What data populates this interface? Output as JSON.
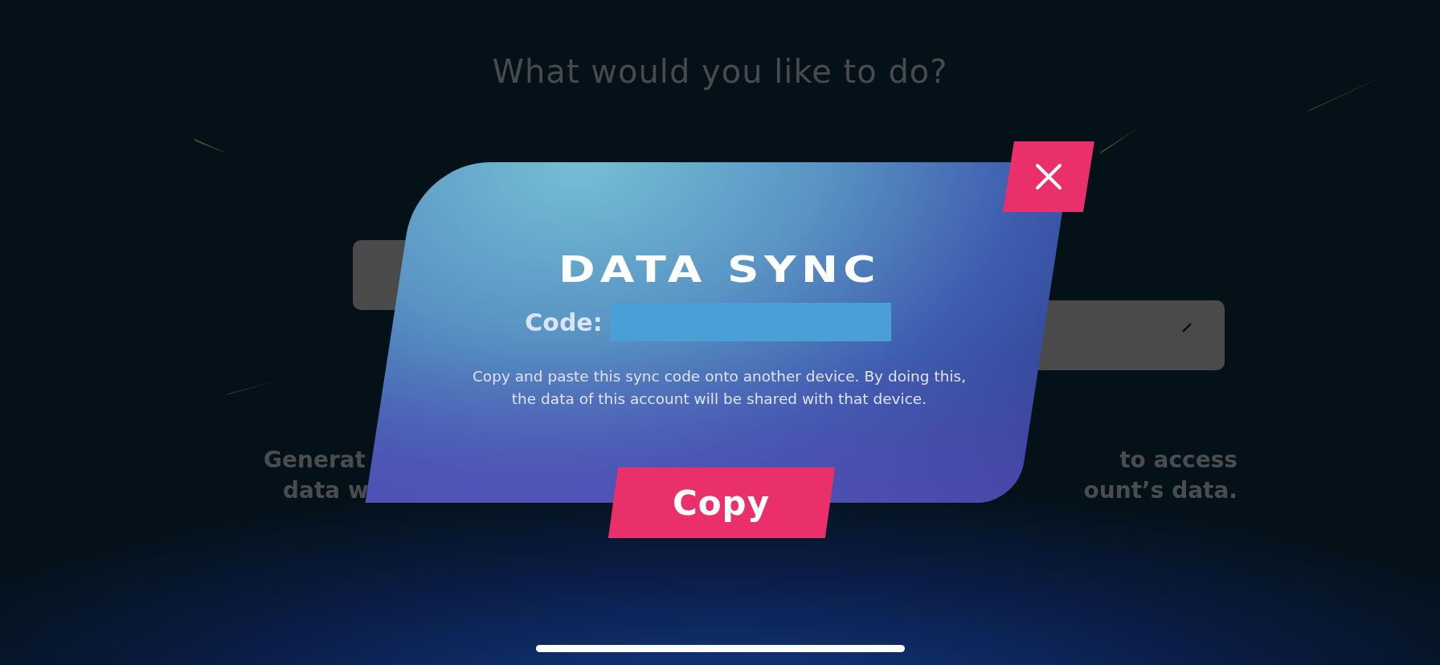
{
  "background": {
    "title": "What would you like to do?",
    "left_text": [
      "Generat",
      "data w"
    ],
    "right_text": [
      "to access",
      "ount’s data."
    ]
  },
  "dialog": {
    "title": "DATA SYNC",
    "code_label": "Code:",
    "message": "Copy and paste this sync code onto another device. By doing this, the data of this account will be shared with that device.",
    "button": "Copy"
  }
}
